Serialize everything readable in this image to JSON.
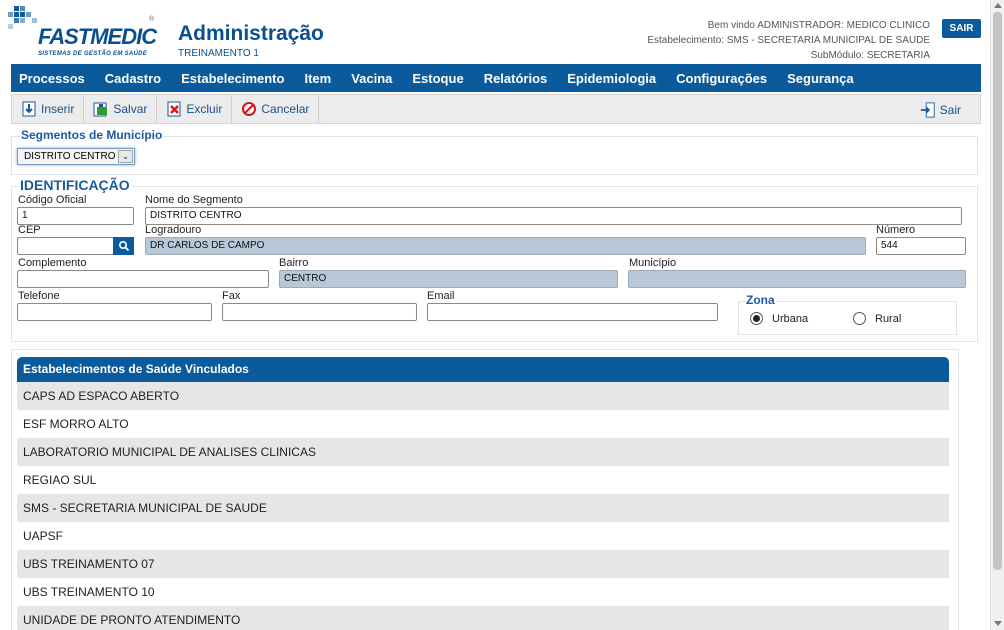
{
  "brand": {
    "logo_text": "FASTMEDIC",
    "logo_tagline": "SISTEMAS DE GESTÃO EM SAÚDE",
    "logo_reg": "®"
  },
  "header": {
    "title": "Administração",
    "subtitle": "TREINAMENTO 1",
    "welcome_line": "Bem vindo ADMINISTRADOR: MEDICO CLINICO",
    "establishment_line": "Estabelecimento: SMS - SECRETARIA MUNICIPAL DE SAUDE",
    "submodule_line": "SubMódulo: SECRETARIA",
    "logout_label": "SAIR"
  },
  "menu": {
    "items": [
      {
        "label": "Processos"
      },
      {
        "label": "Cadastro"
      },
      {
        "label": "Estabelecimento"
      },
      {
        "label": "Item"
      },
      {
        "label": "Vacina"
      },
      {
        "label": "Estoque"
      },
      {
        "label": "Relatórios"
      },
      {
        "label": "Epidemiologia"
      },
      {
        "label": "Configurações"
      },
      {
        "label": "Segurança"
      }
    ]
  },
  "toolbar": {
    "insert_label": "Inserir",
    "save_label": "Salvar",
    "delete_label": "Excluir",
    "cancel_label": "Cancelar",
    "exit_label": "Sair"
  },
  "segment": {
    "legend": "Segmentos de Município",
    "selected": "DISTRITO CENTRO"
  },
  "identification": {
    "legend": "IDENTIFICAÇÃO",
    "codigo_label": "Código Oficial",
    "codigo_value": "1",
    "nome_label": "Nome do Segmento",
    "nome_value": "DISTRITO CENTRO",
    "cep_label": "CEP",
    "cep_value": "",
    "logradouro_label": "Logradouro",
    "logradouro_value": "DR CARLOS DE CAMPO",
    "numero_label": "Número",
    "numero_value": "544",
    "complemento_label": "Complemento",
    "complemento_value": "",
    "bairro_label": "Bairro",
    "bairro_value": "CENTRO",
    "municipio_label": "Município",
    "municipio_value": "",
    "telefone_label": "Telefone",
    "telefone_value": "",
    "fax_label": "Fax",
    "fax_value": "",
    "email_label": "Email",
    "email_value": "",
    "zona_legend": "Zona",
    "zona_urbana_label": "Urbana",
    "zona_rural_label": "Rural",
    "zona_selected": "Urbana"
  },
  "establishments": {
    "header": "Estabelecimentos de Saúde Vinculados",
    "rows": [
      {
        "name": "CAPS AD ESPACO ABERTO"
      },
      {
        "name": "ESF MORRO ALTO"
      },
      {
        "name": "LABORATORIO MUNICIPAL DE ANALISES CLINICAS"
      },
      {
        "name": "REGIAO SUL"
      },
      {
        "name": "SMS - SECRETARIA MUNICIPAL DE SAUDE"
      },
      {
        "name": "UAPSF"
      },
      {
        "name": "UBS TREINAMENTO 07"
      },
      {
        "name": "UBS TREINAMENTO 10"
      },
      {
        "name": "UNIDADE DE PRONTO ATENDIMENTO"
      }
    ]
  },
  "colors": {
    "brand_blue": "#0a5a9c",
    "readonly_field": "#b9c8d6",
    "row_alt": "#e6e6e6"
  }
}
